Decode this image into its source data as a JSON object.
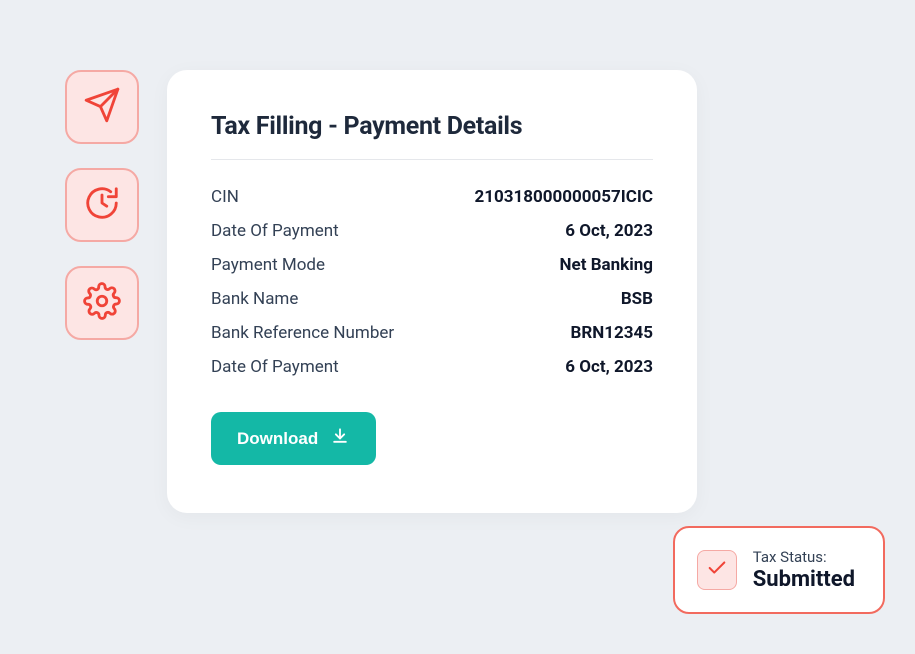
{
  "card": {
    "title": "Tax Filling - Payment Details",
    "rows": [
      {
        "label": "CIN",
        "value": "210318000000057ICIC"
      },
      {
        "label": "Date Of Payment",
        "value": "6 Oct, 2023"
      },
      {
        "label": "Payment Mode",
        "value": "Net Banking"
      },
      {
        "label": "Bank Name",
        "value": "BSB"
      },
      {
        "label": "Bank Reference Number",
        "value": "BRN12345"
      },
      {
        "label": "Date Of Payment",
        "value": "6 Oct, 2023"
      }
    ],
    "download_label": "Download"
  },
  "status": {
    "label": "Tax Status:",
    "value": "Submitted"
  },
  "colors": {
    "accent_red": "#f26a5e",
    "tile_bg": "#fde5e4",
    "tile_border": "#f5a9a4",
    "primary_teal": "#14b8a6"
  }
}
